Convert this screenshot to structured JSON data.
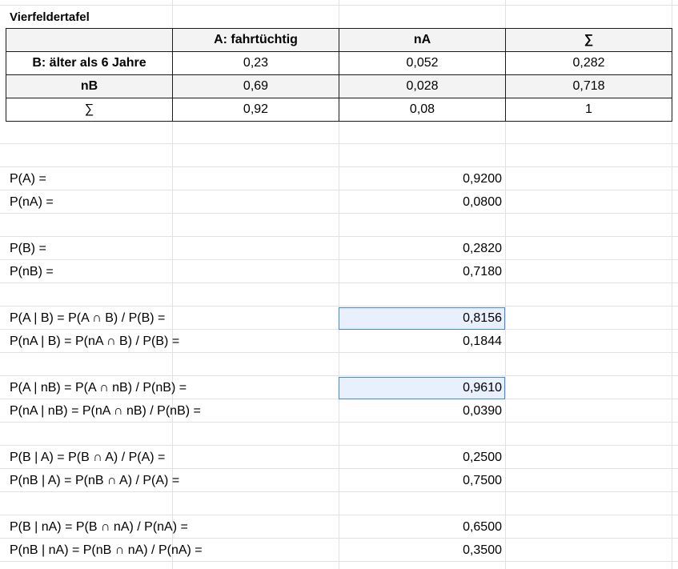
{
  "title": "Vierfeldertafel",
  "table": {
    "header": [
      "",
      "A: fahrtüchtig",
      "nA",
      "∑"
    ],
    "rows": [
      [
        "B: älter als 6 Jahre",
        "0,23",
        "0,052",
        "0,282"
      ],
      [
        "nB",
        "0,69",
        "0,028",
        "0,718"
      ],
      [
        "∑",
        "0,92",
        "0,08",
        "1"
      ]
    ]
  },
  "probabilities": [
    {
      "label": "P(A) =",
      "value": "0,9200",
      "highlighted": false
    },
    {
      "label": "P(nA) =",
      "value": "0,0800",
      "highlighted": false
    },
    {
      "label": "P(B) =",
      "value": "0,2820",
      "highlighted": false
    },
    {
      "label": "P(nB) =",
      "value": "0,7180",
      "highlighted": false
    },
    {
      "label": "P(A | B) = P(A ∩ B) / P(B) =",
      "value": "0,8156",
      "highlighted": true
    },
    {
      "label": "P(nA | B) = P(nA ∩ B) / P(B) =",
      "value": "0,1844",
      "highlighted": false
    },
    {
      "label": "P(A | nB) = P(A ∩ nB) / P(nB) =",
      "value": "0,9610",
      "highlighted": true
    },
    {
      "label": "P(nA | nB) = P(nA ∩ nB) / P(nB) =",
      "value": "0,0390",
      "highlighted": false
    },
    {
      "label": "P(B | A) = P(B ∩ A) / P(A) =",
      "value": "0,2500",
      "highlighted": false
    },
    {
      "label": "P(nB | A) = P(nB ∩ A) / P(A) =",
      "value": "0,7500",
      "highlighted": false
    },
    {
      "label": "P(B | nA) = P(B ∩ nA) / P(nA) =",
      "value": "0,6500",
      "highlighted": false
    },
    {
      "label": "P(nB | nA) = P(nB ∩ nA) / P(nA) =",
      "value": "0,3500",
      "highlighted": false
    }
  ],
  "colors": {
    "grid": "#e2e2e2",
    "header_fill": "#f3f3f3",
    "selection_fill": "#e8f0fe",
    "selection_border": "#4285f4"
  }
}
